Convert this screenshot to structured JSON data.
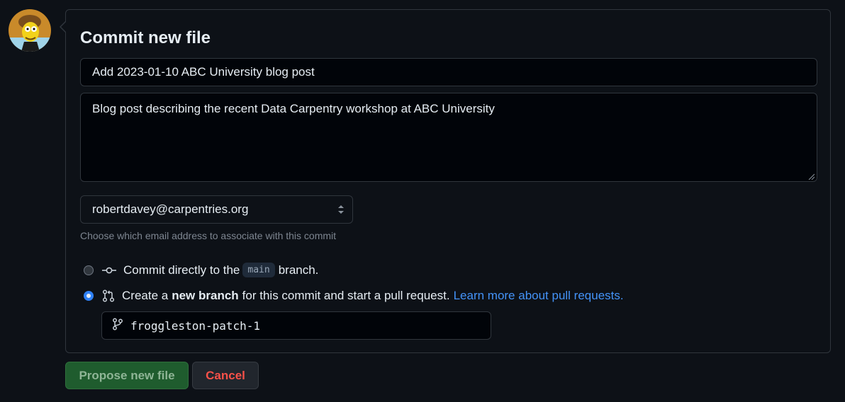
{
  "commit": {
    "title": "Commit new file",
    "summary_value": "Add 2023-01-10 ABC University blog post",
    "description_value": "Blog post describing the recent Data Carpentry workshop at ABC University",
    "email_selected": "robertdavey@carpentries.org",
    "email_help": "Choose which email address to associate with this commit",
    "option_direct": {
      "prefix": "Commit directly to the",
      "branch": "main",
      "suffix": "branch.",
      "selected": false,
      "icon": "git-commit-icon"
    },
    "option_new_branch": {
      "prefix": "Create a",
      "bold": "new branch",
      "suffix": "for this commit and start a pull request.",
      "link": "Learn more about pull requests.",
      "selected": true,
      "icon": "git-pull-request-icon"
    },
    "branch_name": "froggleston-patch-1",
    "branch_icon": "git-branch-icon"
  },
  "actions": {
    "propose_label": "Propose new file",
    "cancel_label": "Cancel"
  },
  "colors": {
    "background": "#0d1117",
    "border": "#30363d",
    "accent_blue": "#2f81f7",
    "link": "#4493f8",
    "propose_bg": "#1f5c2e",
    "danger": "#f85149"
  }
}
